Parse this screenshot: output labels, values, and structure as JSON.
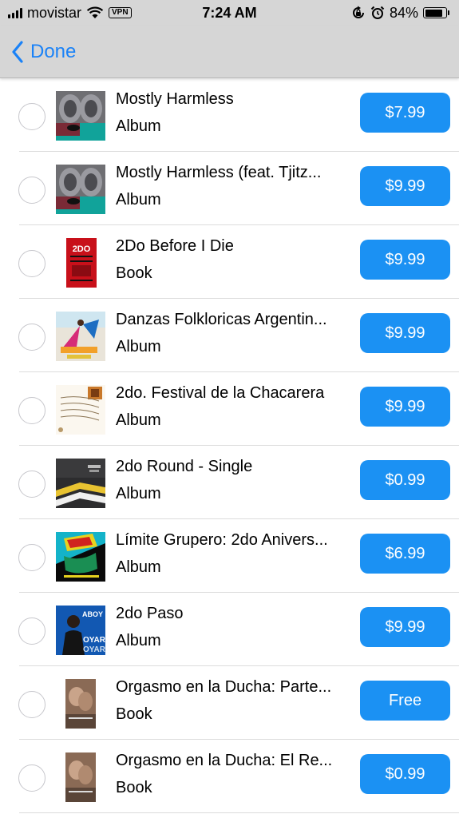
{
  "status_bar": {
    "carrier": "movistar",
    "vpn_label": "VPN",
    "time": "7:24 AM",
    "battery_percent": "84%",
    "battery_level": 0.84
  },
  "nav": {
    "back_label": "Done"
  },
  "items": [
    {
      "title": "Mostly Harmless",
      "subtitle": "Album",
      "price": "$7.99",
      "art": "mostly"
    },
    {
      "title": "Mostly Harmless (feat. Tjitz...",
      "subtitle": "Album",
      "price": "$9.99",
      "art": "mostly"
    },
    {
      "title": "2Do Before I Die",
      "subtitle": "Book",
      "price": "$9.99",
      "art": "book2do"
    },
    {
      "title": "Danzas Folkloricas Argentin...",
      "subtitle": "Album",
      "price": "$9.99",
      "art": "danzas"
    },
    {
      "title": "2do. Festival de la Chacarera",
      "subtitle": "Album",
      "price": "$9.99",
      "art": "festival"
    },
    {
      "title": "2do Round - Single",
      "subtitle": "Album",
      "price": "$0.99",
      "art": "round"
    },
    {
      "title": "Límite Grupero: 2do Anivers...",
      "subtitle": "Album",
      "price": "$6.99",
      "art": "limite"
    },
    {
      "title": "2do Paso",
      "subtitle": "Album",
      "price": "$9.99",
      "art": "paso"
    },
    {
      "title": "Orgasmo en la Ducha: Parte...",
      "subtitle": "Book",
      "price": "Free",
      "art": "ducha"
    },
    {
      "title": "Orgasmo en la Ducha: El Re...",
      "subtitle": "Book",
      "price": "$0.99",
      "art": "ducha"
    }
  ],
  "colors": {
    "accent": "#1a82f7",
    "button": "#1b91f3",
    "bar_bg": "#d6d6d6"
  }
}
